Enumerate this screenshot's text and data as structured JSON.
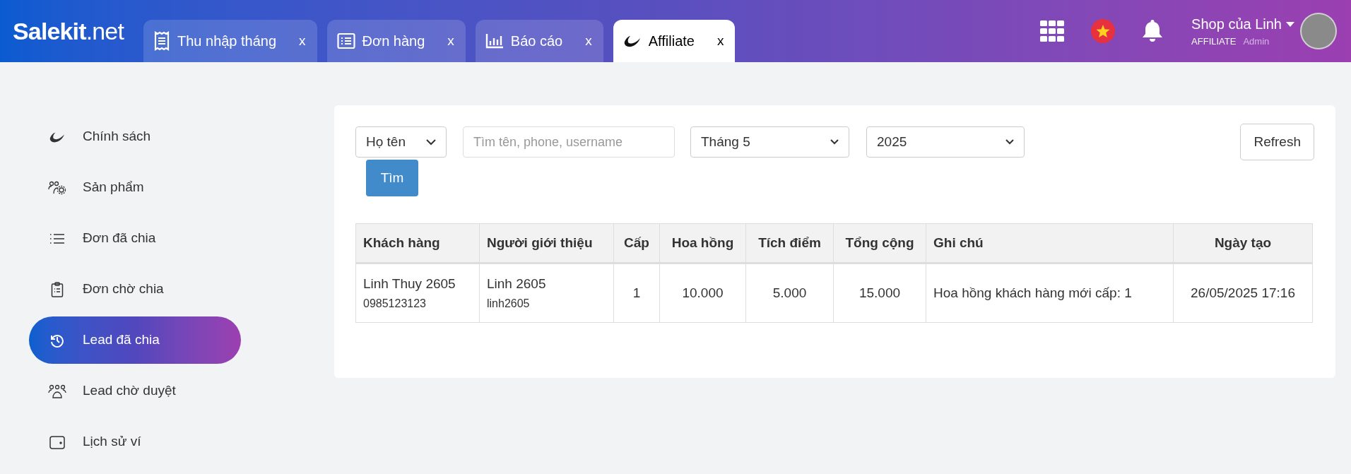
{
  "header": {
    "logo": "**Salekit**.net",
    "tabs": [
      {
        "label": "Thu nhập tháng",
        "close": "x",
        "selected": false
      },
      {
        "label": "Đơn hàng",
        "close": "x",
        "selected": false
      },
      {
        "label": "Báo cáo",
        "close": "x",
        "selected": false
      },
      {
        "label": "Affiliate",
        "close": "x",
        "selected": true
      }
    ],
    "user": {
      "name": "Shop của Linh",
      "role": "AFFILIATE",
      "title": "Admin"
    }
  },
  "sidebar": {
    "items": [
      {
        "label": "Chính sách",
        "selected": false
      },
      {
        "label": "Sản phẩm",
        "selected": false
      },
      {
        "label": "Đơn đã chia",
        "selected": false
      },
      {
        "label": "Đơn chờ chia",
        "selected": false
      },
      {
        "label": "Lead đã chia",
        "selected": true
      },
      {
        "label": "Lead chờ duyệt",
        "selected": false
      },
      {
        "label": "Lịch sử ví",
        "selected": false
      }
    ]
  },
  "filters": {
    "field_select": "Họ tên",
    "search": {
      "placeholder": "Tìm tên, phone, username"
    },
    "month": "Tháng 5",
    "year": "2025",
    "search_button": "Tìm",
    "refresh_button": "Refresh"
  },
  "table": {
    "columns": [
      "Khách hàng",
      "Người giới thiệu",
      "Cấp",
      "Hoa hồng",
      "Tích điểm",
      "Tổng cộng",
      "Ghi chú",
      "Ngày tạo"
    ],
    "rows": [
      {
        "customer": "Linh Thuy 2605",
        "customer_phone": "0985123123",
        "referrer": "Linh 2605",
        "referrer_username": "linh2605",
        "level": "1",
        "commission": "10.000",
        "points": "5.000",
        "total": "15.000",
        "note": "Hoa hồng khách hàng mới cấp: 1",
        "created": "26/05/2025 17:16"
      }
    ]
  }
}
